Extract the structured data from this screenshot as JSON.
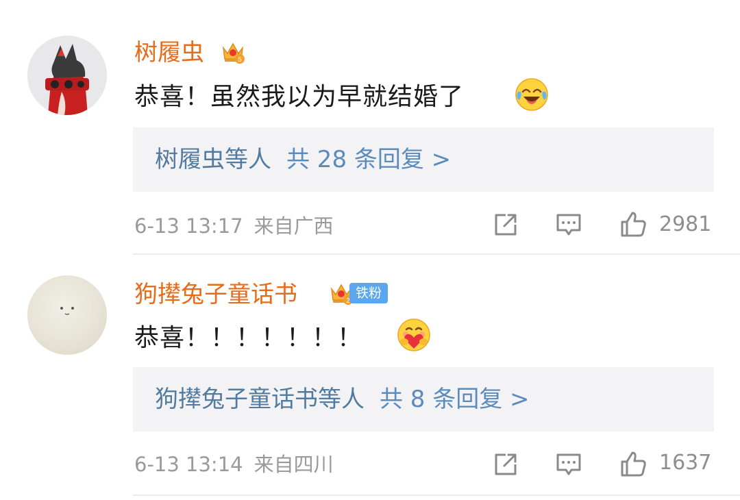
{
  "comments": [
    {
      "username": "树履虫",
      "badge_level": "5",
      "text": "恭喜！虽然我以为早就结婚了",
      "emoji": "laughing-crying-emoji",
      "reply": {
        "who": "树履虫",
        "etc": "等人",
        "count": "共 28 条回复 >"
      },
      "time": "6-13 13:17",
      "location": "来自广西",
      "likes": "2981"
    },
    {
      "username": "狗撵兔子童话书",
      "badge_level": "2",
      "fan_badge": "铁粉",
      "text": "恭喜！！！！！！！",
      "emoji": "hugging-heart-emoji",
      "reply": {
        "who": "狗撵兔子童话书",
        "etc": "等人",
        "count": "共 8 条回复 >"
      },
      "time": "6-13 13:14",
      "location": "来自四川",
      "likes": "1637"
    }
  ],
  "colors": {
    "username": "#e86b18",
    "reply_link": "#527b9f",
    "meta": "#9a9a9a",
    "reply_bg": "#f3f3f5",
    "fan_badge_bg": "#5aa6ef"
  },
  "icons": [
    "crown-badge-icon",
    "share-icon",
    "comment-icon",
    "thumbs-up-icon"
  ]
}
